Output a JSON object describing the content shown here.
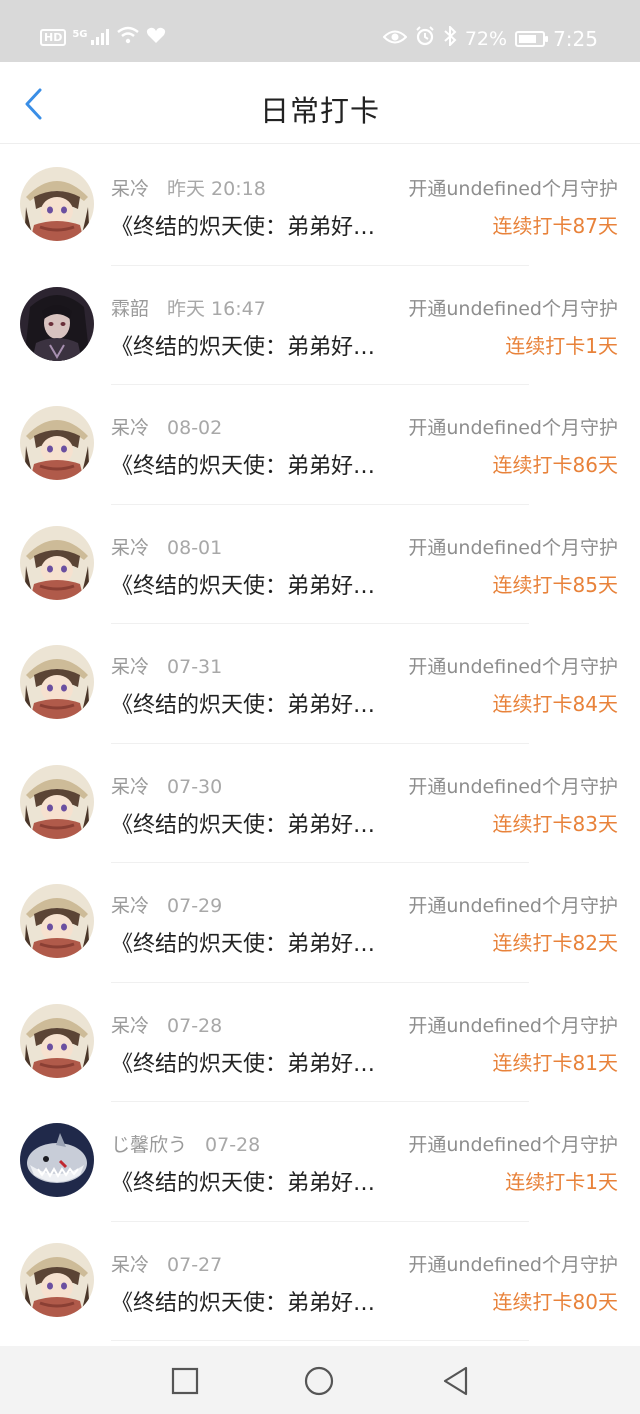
{
  "status_bar": {
    "left_badge": "HD",
    "network": "5G",
    "battery_percent": "72%",
    "time": "7:25"
  },
  "header": {
    "title": "日常打卡"
  },
  "checkins": [
    {
      "name": "呆冷",
      "time": "昨天 20:18",
      "guard": "开通undefined个月守护",
      "book": "《终结的炽天使：弟弟好…",
      "streak": "连续打卡87天",
      "avatar": "avatar-girl-hat"
    },
    {
      "name": "霖韶",
      "time": "昨天 16:47",
      "guard": "开通undefined个月守护",
      "book": "《终结的炽天使：弟弟好…",
      "streak": "连续打卡1天",
      "avatar": "avatar-dark-hair"
    },
    {
      "name": "呆冷",
      "time": "08-02",
      "guard": "开通undefined个月守护",
      "book": "《终结的炽天使：弟弟好…",
      "streak": "连续打卡86天",
      "avatar": "avatar-girl-hat"
    },
    {
      "name": "呆冷",
      "time": "08-01",
      "guard": "开通undefined个月守护",
      "book": "《终结的炽天使：弟弟好…",
      "streak": "连续打卡85天",
      "avatar": "avatar-girl-hat"
    },
    {
      "name": "呆冷",
      "time": "07-31",
      "guard": "开通undefined个月守护",
      "book": "《终结的炽天使：弟弟好…",
      "streak": "连续打卡84天",
      "avatar": "avatar-girl-hat"
    },
    {
      "name": "呆冷",
      "time": "07-30",
      "guard": "开通undefined个月守护",
      "book": "《终结的炽天使：弟弟好…",
      "streak": "连续打卡83天",
      "avatar": "avatar-girl-hat"
    },
    {
      "name": "呆冷",
      "time": "07-29",
      "guard": "开通undefined个月守护",
      "book": "《终结的炽天使：弟弟好…",
      "streak": "连续打卡82天",
      "avatar": "avatar-girl-hat"
    },
    {
      "name": "呆冷",
      "time": "07-28",
      "guard": "开通undefined个月守护",
      "book": "《终结的炽天使：弟弟好…",
      "streak": "连续打卡81天",
      "avatar": "avatar-girl-hat"
    },
    {
      "name": "じ馨欣う",
      "time": "07-28",
      "guard": "开通undefined个月守护",
      "book": "《终结的炽天使：弟弟好…",
      "streak": "连续打卡1天",
      "avatar": "avatar-shark"
    },
    {
      "name": "呆冷",
      "time": "07-27",
      "guard": "开通undefined个月守护",
      "book": "《终结的炽天使：弟弟好…",
      "streak": "连续打卡80天",
      "avatar": "avatar-girl-hat"
    }
  ],
  "colors": {
    "accent": "#3a8ee6",
    "streak": "#e8823a",
    "status_bar": "#d9d9d9"
  }
}
